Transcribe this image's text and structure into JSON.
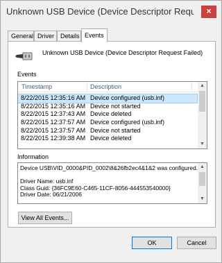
{
  "window": {
    "title": "Unknown USB Device (Device Descriptor Request Fail...",
    "close_glyph": "×"
  },
  "tabs": [
    {
      "label": "General"
    },
    {
      "label": "Driver"
    },
    {
      "label": "Details"
    },
    {
      "label": "Events",
      "active": true
    }
  ],
  "device": {
    "icon": "usb-connector-icon",
    "name": "Unknown USB Device (Device Descriptor Request Failed)"
  },
  "events": {
    "section_label": "Events",
    "columns": [
      "Timestamp",
      "Description"
    ],
    "rows": [
      {
        "timestamp": "8/22/2015 12:35:16 AM",
        "description": "Device configured (usb.inf)",
        "selected": true
      },
      {
        "timestamp": "8/22/2015 12:35:16 AM",
        "description": "Device not started"
      },
      {
        "timestamp": "8/22/2015 12:37:43 AM",
        "description": "Device deleted"
      },
      {
        "timestamp": "8/22/2015 12:37:57 AM",
        "description": "Device configured (usb.inf)"
      },
      {
        "timestamp": "8/22/2015 12:37:57 AM",
        "description": "Device not started"
      },
      {
        "timestamp": "8/22/2015 12:39:38 AM",
        "description": "Device deleted"
      }
    ]
  },
  "information": {
    "section_label": "Information",
    "lines": [
      "Device USB\\VID_0000&PID_0002\\8&26fb2ec4&1&2 was configured.",
      "",
      "Driver Name: usb.inf",
      "Class Guid: {36FC9E60-C465-11CF-8056-444553540000}",
      "Driver Date: 06/21/2006"
    ]
  },
  "buttons": {
    "view_all_events": "View All Events...",
    "ok": "OK",
    "cancel": "Cancel"
  },
  "colors": {
    "close_button": "#c74343",
    "selection": "#cce8ff",
    "header_text": "#4c607a"
  }
}
